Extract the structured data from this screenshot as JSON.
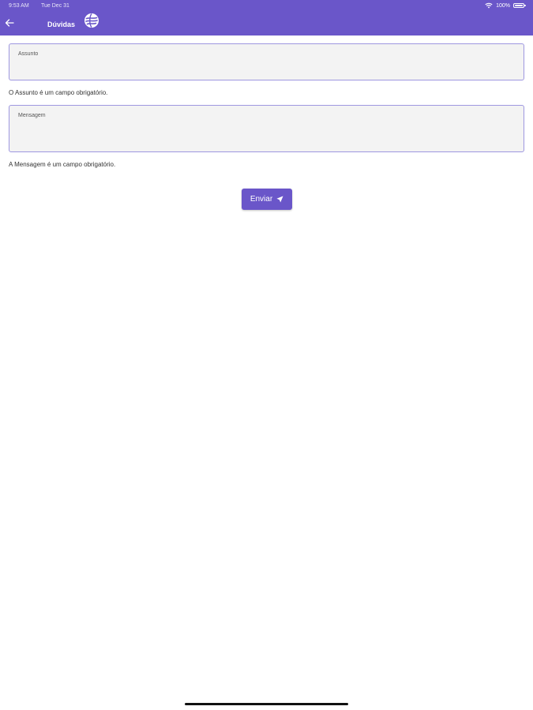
{
  "status_bar": {
    "time": "9:53 AM",
    "date": "Tue Dec 31",
    "battery": "100%"
  },
  "header": {
    "title": "Dúvidas"
  },
  "form": {
    "subject_label": "Assunto",
    "subject_error": "O Assunto é um campo obrigatório.",
    "message_label": "Mensagem",
    "message_error": "A Mensagem é um campo obrigatório.",
    "send_label": "Enviar"
  },
  "icons": {
    "back": "arrow-left-icon",
    "logo": "globe-logo-icon",
    "send": "paper-plane-icon",
    "wifi": "wifi-icon",
    "battery": "battery-icon"
  },
  "colors": {
    "primary": "#6a56c9",
    "field_border": "#9e97e0",
    "field_background": "#f3f3f3"
  }
}
